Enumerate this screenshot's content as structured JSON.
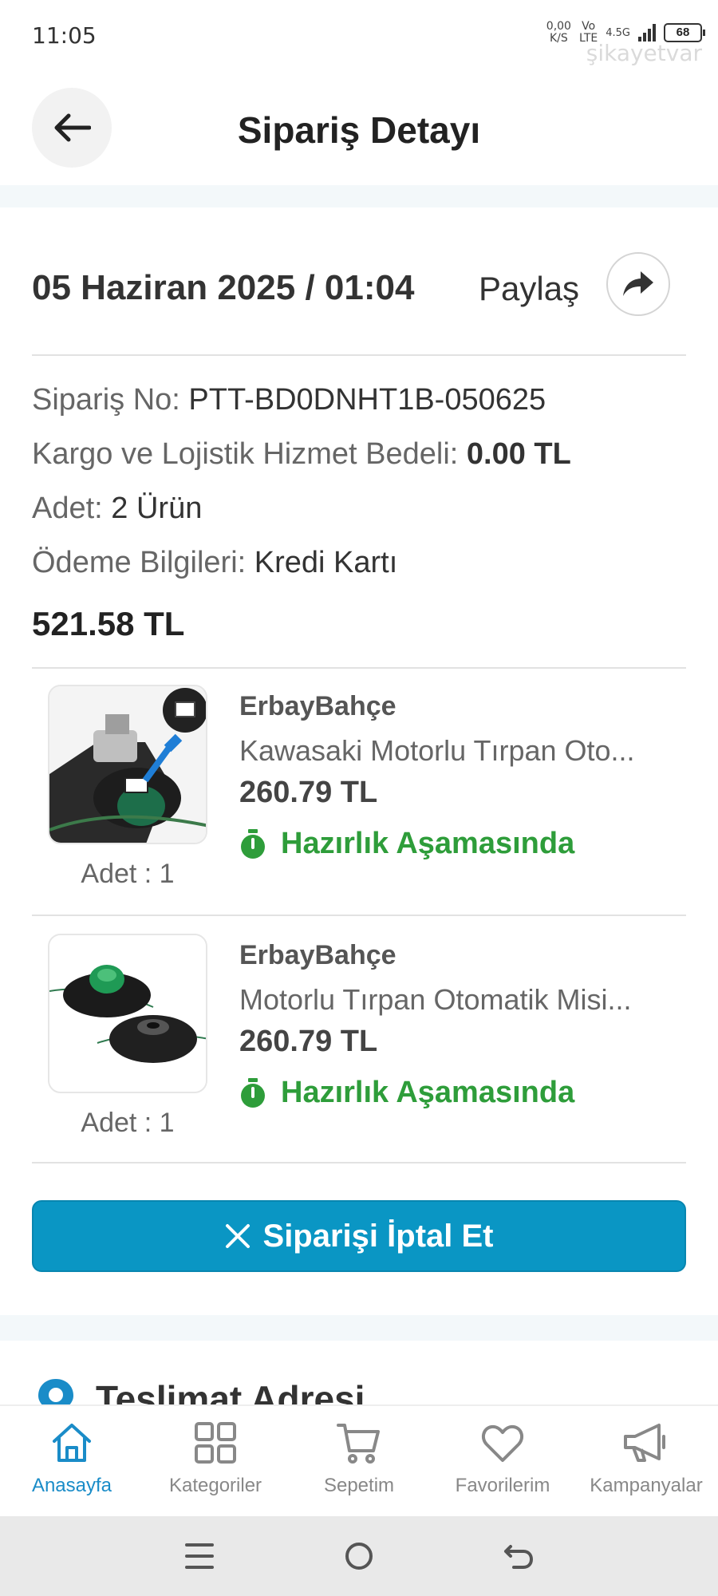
{
  "status_bar": {
    "time": "11:05",
    "net_speed_value": "0,00",
    "net_speed_unit": "K/S",
    "volte_top": "Vo",
    "volte_bottom": "LTE",
    "network": "4.5G",
    "battery": "68",
    "watermark": "şikayetvar"
  },
  "header": {
    "title": "Sipariş Detayı"
  },
  "order": {
    "date": "05 Haziran 2025 / 01:04",
    "share_label": "Paylaş",
    "order_no_label": "Sipariş No: ",
    "order_no_value": "PTT-BD0DNHT1B-050625",
    "shipping_label": "Kargo ve Lojistik Hizmet Bedeli: ",
    "shipping_value": "0.00 TL",
    "count_label": "Adet: ",
    "count_value": "2 Ürün",
    "payment_label": "Ödeme Bilgileri: ",
    "payment_value": "Kredi Kartı",
    "total": "521.58 TL"
  },
  "products": [
    {
      "seller": "ErbayBahçe",
      "name": "Kawasaki Motorlu Tırpan Oto...",
      "price": "260.79 TL",
      "status": "Hazırlık Aşamasında",
      "quantity": "Adet : 1"
    },
    {
      "seller": "ErbayBahçe",
      "name": "Motorlu Tırpan Otomatik Misi...",
      "price": "260.79 TL",
      "status": "Hazırlık Aşamasında",
      "quantity": "Adet : 1"
    }
  ],
  "cancel_button": {
    "label": "Siparişi İptal Et"
  },
  "delivery": {
    "title": "Teslimat Adresi"
  },
  "bottom_nav": {
    "items": [
      {
        "label": "Anasayfa",
        "icon": "home-icon",
        "active": true
      },
      {
        "label": "Kategoriler",
        "icon": "grid-icon",
        "active": false
      },
      {
        "label": "Sepetim",
        "icon": "cart-icon",
        "active": false
      },
      {
        "label": "Favorilerim",
        "icon": "heart-icon",
        "active": false
      },
      {
        "label": "Kampanyalar",
        "icon": "megaphone-icon",
        "active": false
      }
    ]
  },
  "colors": {
    "accent": "#1a8cc8",
    "cancel_button": "#0a96c4",
    "status_green": "#2e9d3a"
  }
}
